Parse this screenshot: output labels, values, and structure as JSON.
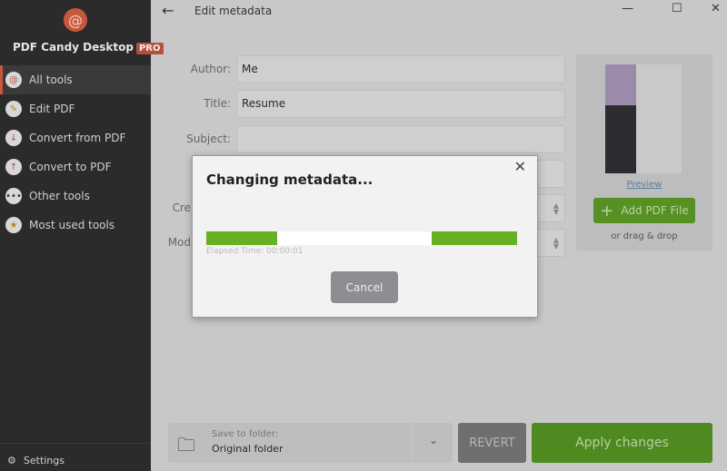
{
  "app": {
    "name": "PDF Candy Desktop",
    "badge": "PRO"
  },
  "sidebar": {
    "items": [
      {
        "label": "All tools",
        "icon": "lollipop-icon",
        "active": true
      },
      {
        "label": "Edit PDF",
        "icon": "edit-icon"
      },
      {
        "label": "Convert from PDF",
        "icon": "arrow-down-icon"
      },
      {
        "label": "Convert to PDF",
        "icon": "arrow-up-icon"
      },
      {
        "label": "Other tools",
        "icon": "more-icon"
      },
      {
        "label": "Most used tools",
        "icon": "star-icon"
      }
    ],
    "settings": "Settings"
  },
  "header": {
    "title": "Edit metadata"
  },
  "form": {
    "author_label": "Author:",
    "author": "Me",
    "title_label": "Title:",
    "title": "Resume",
    "subject_label": "Subject:",
    "subject": "",
    "keywords_label": "Ke",
    "created_label": "Cre",
    "modified_label": "Mod"
  },
  "preview": {
    "link": "Preview",
    "add_button": "Add PDF File",
    "drag": "or drag & drop"
  },
  "footer": {
    "save_label": "Save to folder:",
    "folder": "Original folder",
    "revert": "REVERT",
    "apply": "Apply changes"
  },
  "dialog": {
    "title": "Changing metadata...",
    "elapsed": "Elapsed Time: 00:00:01",
    "cancel": "Cancel",
    "progress_color": "#68b023"
  }
}
